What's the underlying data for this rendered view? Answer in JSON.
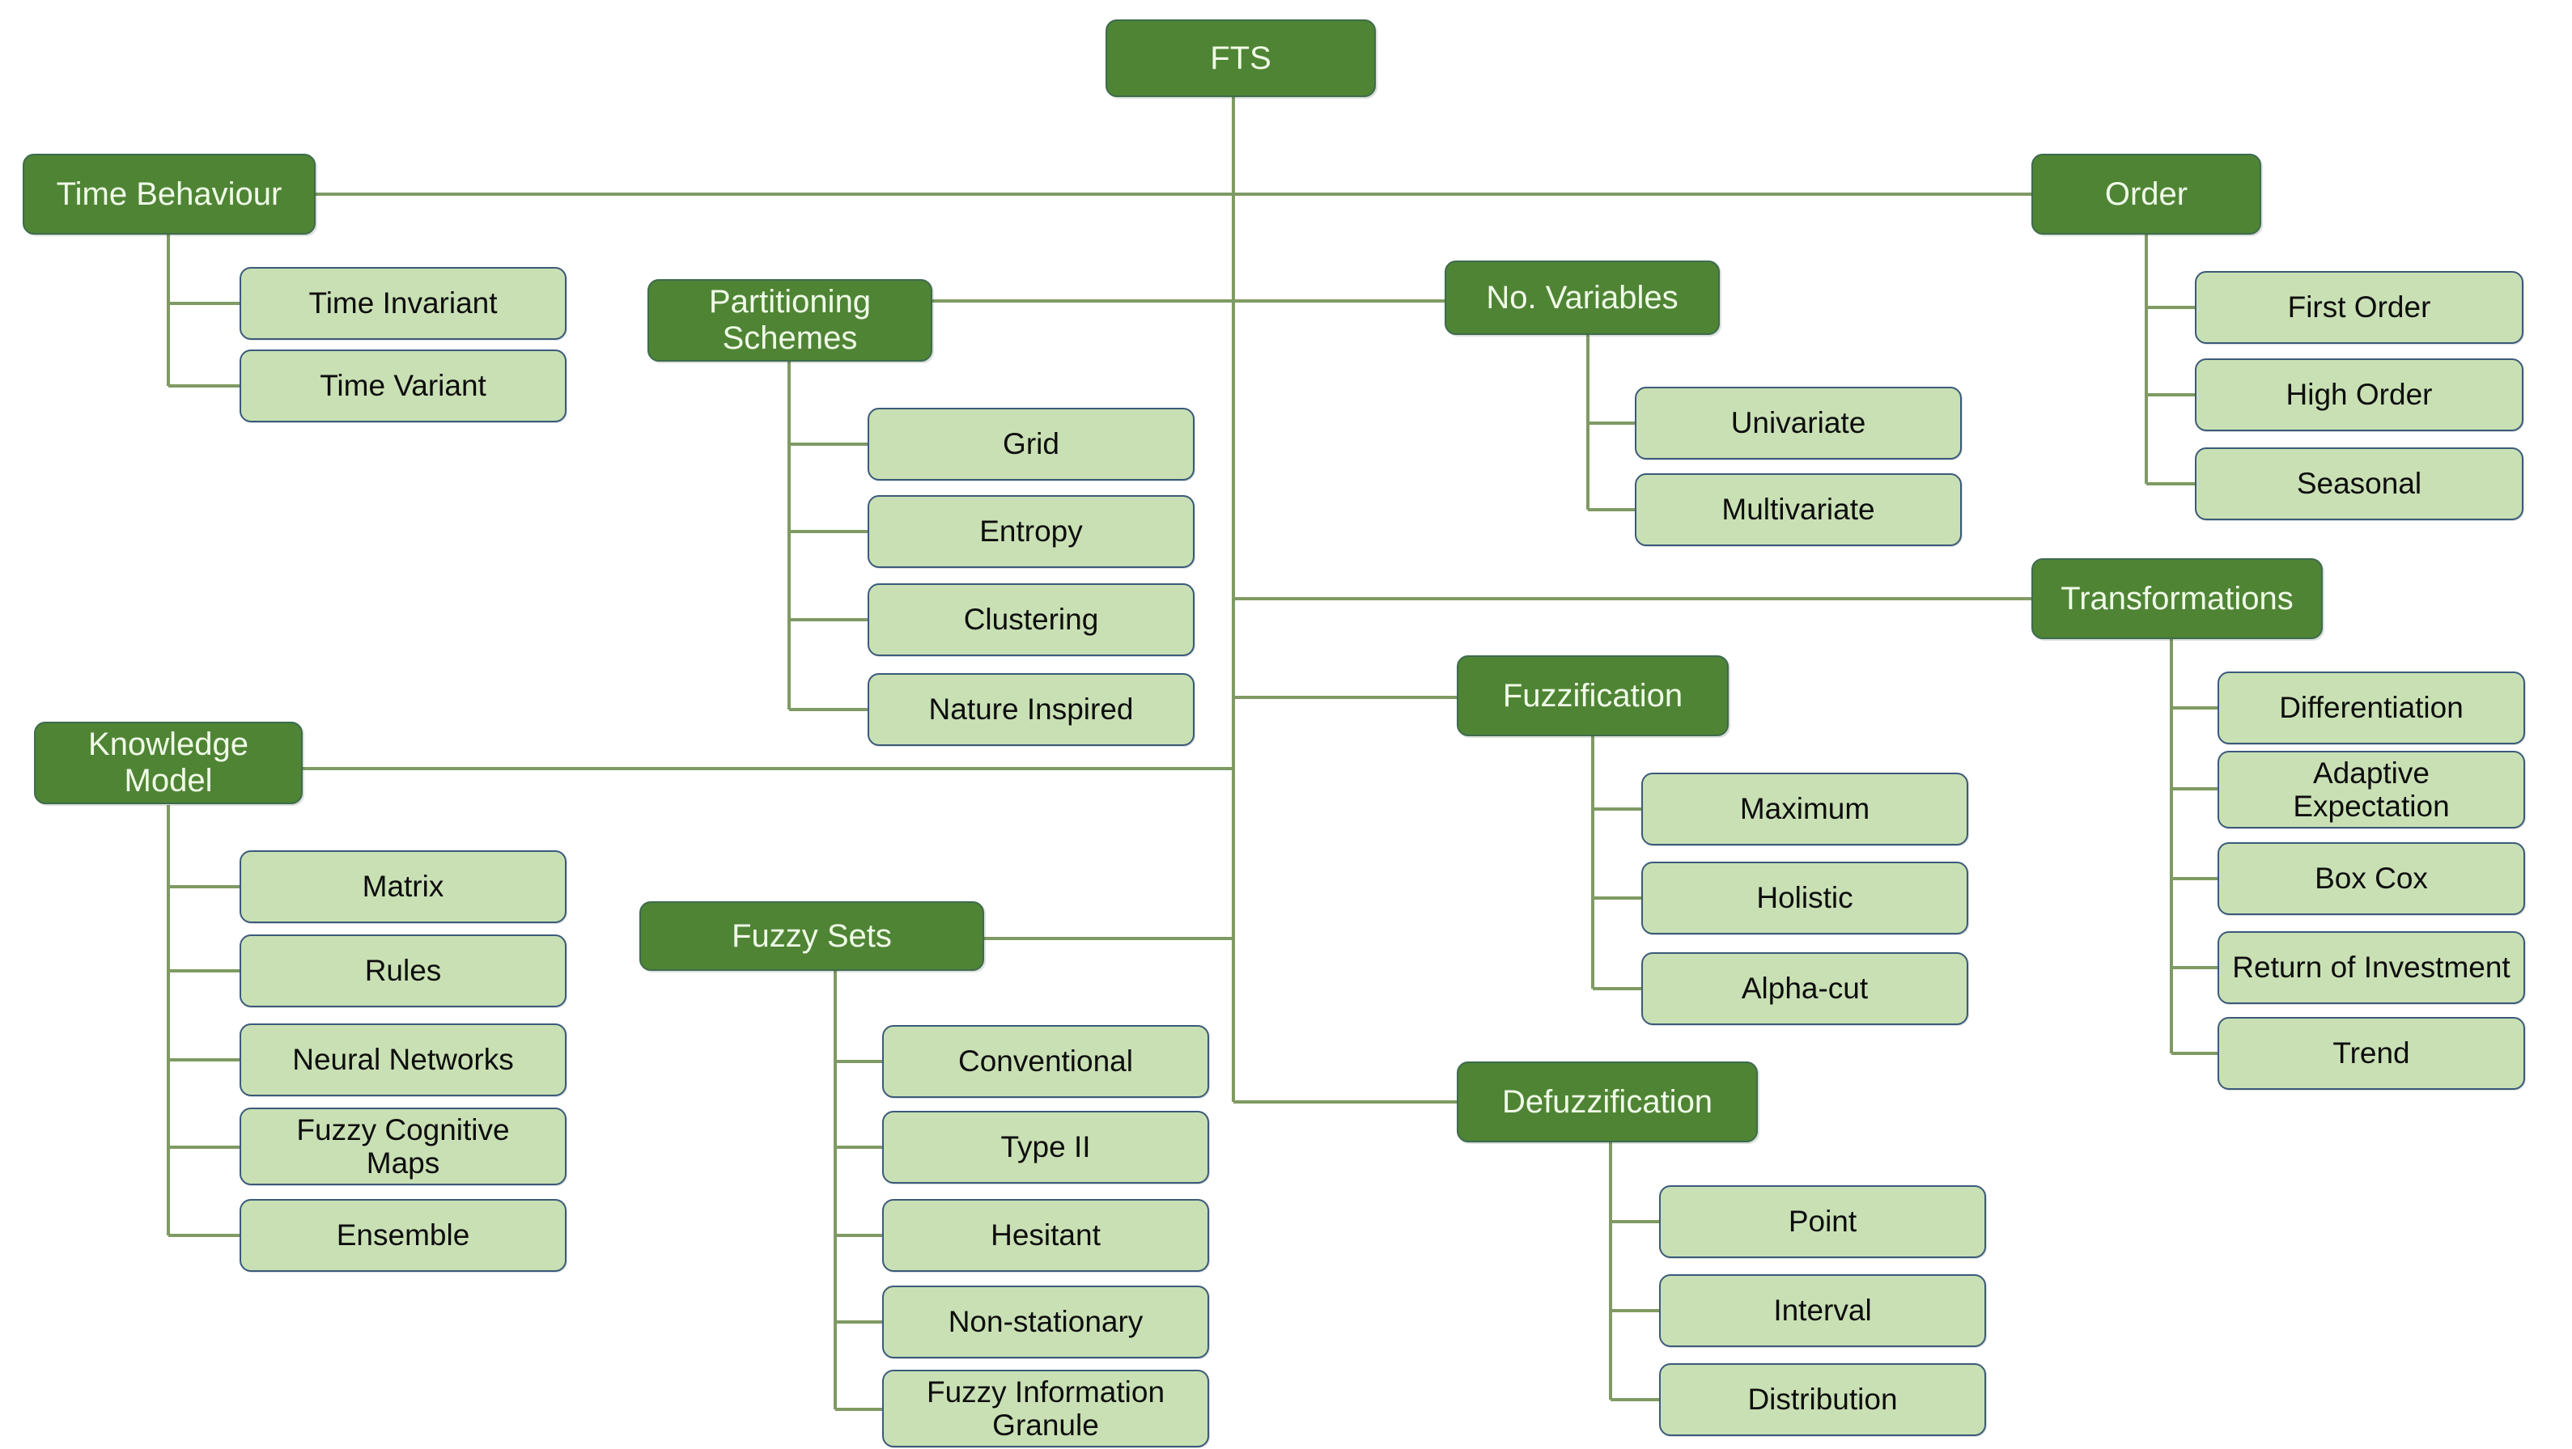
{
  "diagram": {
    "title": "FTS",
    "colors": {
      "primary_fill": "#4f8435",
      "primary_border": "#3d6b4e",
      "primary_text": "#f0fbe8",
      "leaf_fill": "#c9e0b4",
      "leaf_border": "#3b5a7a",
      "leaf_text": "#0d0d0d",
      "connector": "#7f9a63",
      "background": "#ffffff"
    },
    "root": {
      "label": "FTS"
    },
    "branches": [
      {
        "id": "time-behaviour",
        "label": "Time Behaviour",
        "children": [
          {
            "label": "Time Invariant"
          },
          {
            "label": "Time Variant"
          }
        ]
      },
      {
        "id": "partitioning-schemes",
        "label": "Partitioning\nSchemes",
        "children": [
          {
            "label": "Grid"
          },
          {
            "label": "Entropy"
          },
          {
            "label": "Clustering"
          },
          {
            "label": "Nature Inspired"
          }
        ]
      },
      {
        "id": "no-variables",
        "label": "No. Variables",
        "children": [
          {
            "label": "Univariate"
          },
          {
            "label": "Multivariate"
          }
        ]
      },
      {
        "id": "order",
        "label": "Order",
        "children": [
          {
            "label": "First Order"
          },
          {
            "label": "High Order"
          },
          {
            "label": "Seasonal"
          }
        ]
      },
      {
        "id": "transformations",
        "label": "Transformations",
        "children": [
          {
            "label": "Differentiation"
          },
          {
            "label": "Adaptive\nExpectation"
          },
          {
            "label": "Box Cox"
          },
          {
            "label": "Return of Investment"
          },
          {
            "label": "Trend"
          }
        ]
      },
      {
        "id": "knowledge-model",
        "label": "Knowledge\nModel",
        "children": [
          {
            "label": "Matrix"
          },
          {
            "label": "Rules"
          },
          {
            "label": "Neural Networks"
          },
          {
            "label": "Fuzzy Cognitive\nMaps"
          },
          {
            "label": "Ensemble"
          }
        ]
      },
      {
        "id": "fuzzification",
        "label": "Fuzzification",
        "children": [
          {
            "label": "Maximum"
          },
          {
            "label": "Holistic"
          },
          {
            "label": "Alpha-cut"
          }
        ]
      },
      {
        "id": "fuzzy-sets",
        "label": "Fuzzy Sets",
        "children": [
          {
            "label": "Conventional"
          },
          {
            "label": "Type II"
          },
          {
            "label": "Hesitant"
          },
          {
            "label": "Non-stationary"
          },
          {
            "label": "Fuzzy Information\nGranule"
          }
        ]
      },
      {
        "id": "defuzzification",
        "label": "Defuzzification",
        "children": [
          {
            "label": "Point"
          },
          {
            "label": "Interval"
          },
          {
            "label": "Distribution"
          }
        ]
      }
    ]
  }
}
